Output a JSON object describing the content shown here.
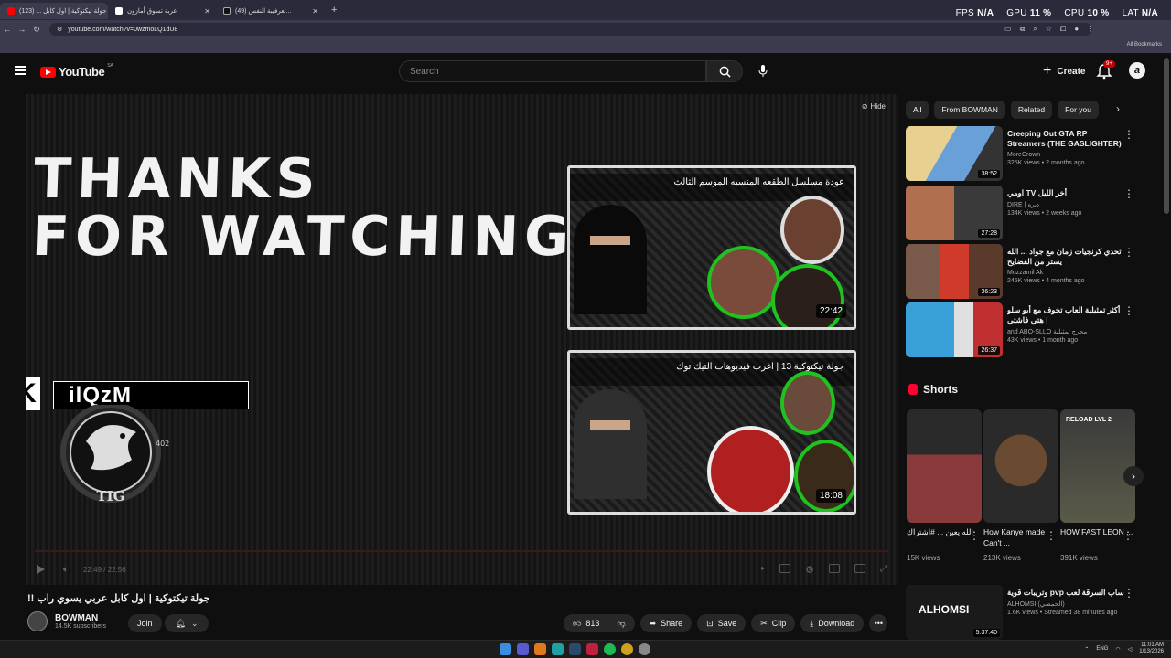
{
  "browser": {
    "tabs": [
      {
        "title": "جولة تيكتوكية | اول كابل ... (123)",
        "favicon_color": "#ff0000",
        "active": true
      },
      {
        "title": "عربة تسوق أمازون",
        "favicon_color": "#ffffff",
        "active": false
      },
      {
        "title": "تعرفيبة النفس (49)...",
        "favicon_color": "#111111",
        "active": false
      }
    ],
    "url": "youtube.com/watch?v=0wzmoLQ1dU8",
    "bookmarks_label": "All Bookmarks",
    "perf": [
      {
        "label": "FPS",
        "value": "N/A"
      },
      {
        "label": "GPU",
        "value": "11 %"
      },
      {
        "label": "CPU",
        "value": "10 %"
      },
      {
        "label": "LAT",
        "value": "N/A"
      }
    ]
  },
  "masthead": {
    "logo_text": "YouTube",
    "country_code": "SA",
    "search_placeholder": "Search",
    "create_label": "Create",
    "notification_badge": "9+",
    "avatar_letter": "a"
  },
  "player": {
    "hide_label": "Hide",
    "thanks_line1": "THANKS",
    "thanks_line2": "FOR WATCHING",
    "gamertag": "ilQzM",
    "emblem_text": "TIG",
    "emblem_num": "402",
    "time_display": "22:49 / 22:56",
    "endcards": [
      {
        "title": "عودة مسلسل الطقعه المنسيه الموسم الثالث",
        "duration": "22:42"
      },
      {
        "title": "جولة تيكتوكية 13 | اغرب فيديوهات التيك توك",
        "duration": "18:08"
      }
    ]
  },
  "video": {
    "title": "!! جولة تيكتوكية | اول كابل عربي يسوي راب",
    "channel_name": "BOWMAN",
    "subscribers": "14.5K subscribers",
    "join_label": "Join",
    "likes": "813",
    "share_label": "Share",
    "save_label": "Save",
    "clip_label": "Clip",
    "download_label": "Download"
  },
  "chips": [
    "All",
    "From BOWMAN",
    "Related",
    "For you"
  ],
  "recommendations": [
    {
      "title": "Creeping Out GTA RP Streamers (THE GASLIGHTER)",
      "channel": "MoreCrown",
      "meta": "325K views • 2 months ago",
      "duration": "38:52",
      "thumb_color": "#6aa0d8"
    },
    {
      "title": "اومي TV أخر الليل",
      "channel": "DIRE | ديره",
      "meta": "134K views • 2 weeks ago",
      "duration": "27:28",
      "thumb_color": "#b07050"
    },
    {
      "title": "تحدي كرنجيات زمان مع جواد ... الله يستر من الفضايح",
      "channel": "Muzzamil Ak",
      "meta": "245K views • 4 months ago",
      "duration": "36:23",
      "thumb_color": "#d03a2a"
    },
    {
      "title": "أكثر تمثيلية العاب تخوف مع أبو سلو | هتي فاشتي",
      "channel": "and ABO-SLLO مجرج تمثيلية",
      "meta": "43K views • 1 month ago",
      "duration": "26:37",
      "thumb_color": "#3aa0d8"
    }
  ],
  "shorts": {
    "heading": "Shorts",
    "items": [
      {
        "title": "الله يعين ... #اشتراك",
        "views": "15K views",
        "color": "#7a3a3a"
      },
      {
        "title": "How Kanye made Can't ...",
        "views": "213K views",
        "color": "#5a4030"
      },
      {
        "title": "HOW FAST LEON ...",
        "views": "391K views",
        "color": "#4a4a3a"
      }
    ],
    "item3_overlay": "RELOAD LVL 2"
  },
  "live_rec": {
    "title": "ساب السرقة لعب pvp وتريبات قوية",
    "channel": "ALHOMSI (الحمصي)",
    "meta": "1.6K views • Streamed 38 minutes ago",
    "thumb_text": "ALHOMSI",
    "duration": "5:37:40"
  },
  "taskbar": {
    "lang": "ENG",
    "time": "11:01 AM",
    "date": "1/13/2026"
  }
}
